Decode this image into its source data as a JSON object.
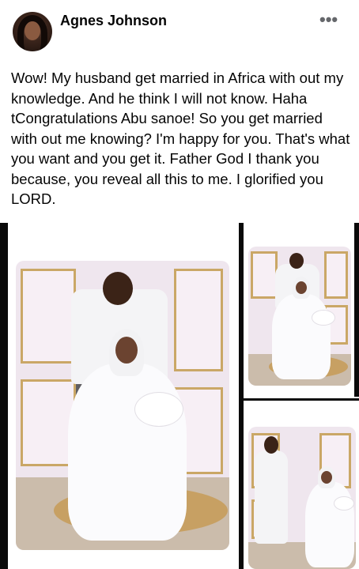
{
  "post": {
    "author": "Agnes Johnson",
    "more_icon": "more-horizontal-icon",
    "text": "Wow! My husband get married in Africa with out my knowledge. And he think I will not know. Haha tCongratulations Abu sanoe! So you get married with out me knowing? I'm happy for you. That's what you want and you get it. Father God I thank you because, you reveal all this to me. I glorified you LORD."
  },
  "colors": {
    "text": "#050505",
    "secondary": "#65676b",
    "wall": "#f7eff5",
    "panel_trim": "#caa766",
    "rug": "#c7a063"
  }
}
